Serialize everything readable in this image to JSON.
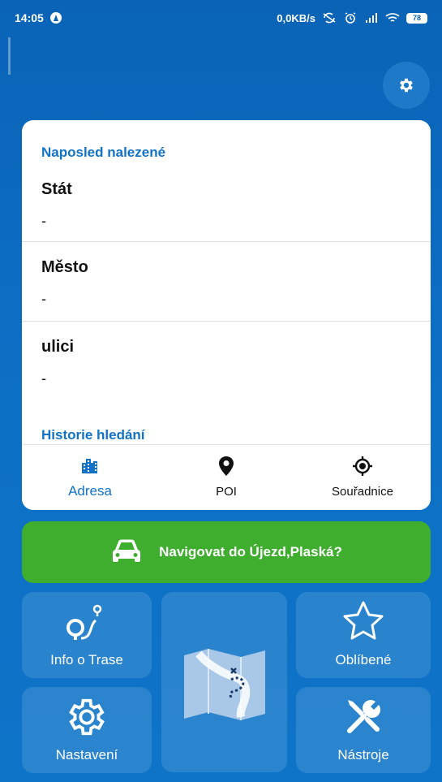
{
  "status_bar": {
    "time": "14:05",
    "net_speed": "0,0KB/s",
    "battery": "78"
  },
  "recent": {
    "section_title": "Naposled nalezené",
    "rows": [
      {
        "label": "Stát",
        "value": "-"
      },
      {
        "label": "Město",
        "value": "-"
      },
      {
        "label": "ulici",
        "value": "-"
      }
    ],
    "history_title": "Historie hledání"
  },
  "tabs": [
    {
      "label": "Adresa",
      "icon": "building-icon",
      "active": true
    },
    {
      "label": "POI",
      "icon": "map-pin-icon",
      "active": false
    },
    {
      "label": "Souřadnice",
      "icon": "crosshair-icon",
      "active": false
    }
  ],
  "navigate_button": {
    "label": "Navigovat do Újezd,Plaská?",
    "icon": "car-icon"
  },
  "tiles": {
    "route_info": "Info o Trase",
    "favorites": "Oblíbené",
    "settings": "Nastavení",
    "tools": "Nástroje"
  },
  "colors": {
    "background": "#0a63b6",
    "accent": "#1273c6",
    "navigate_green": "#3fad2e"
  }
}
